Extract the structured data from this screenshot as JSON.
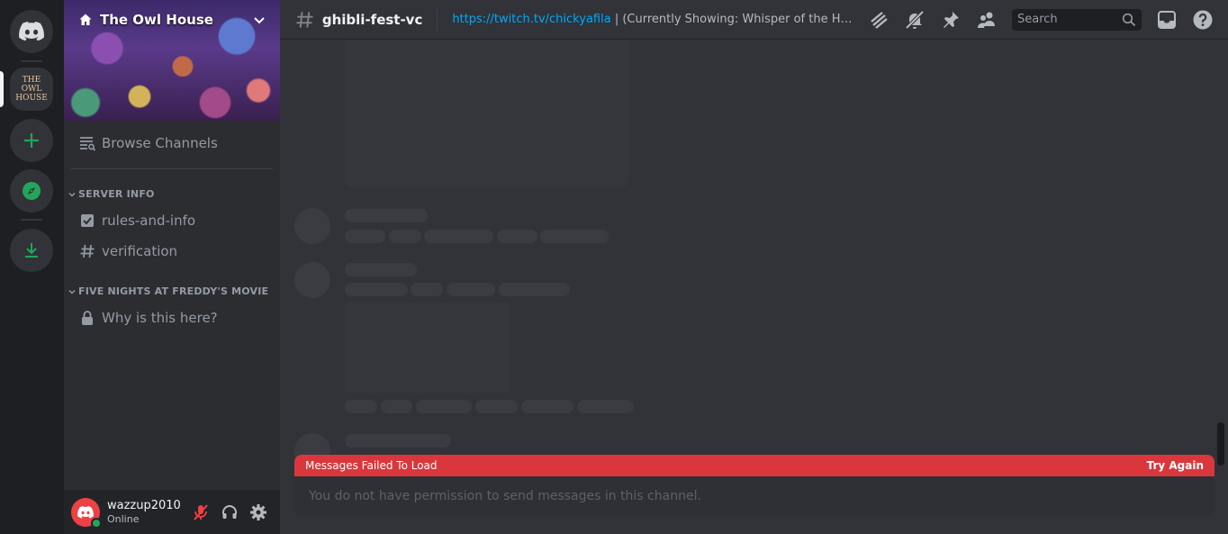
{
  "server": {
    "name": "The Owl House",
    "rail_icon_text": "THE OWL HOUSE"
  },
  "sidebar": {
    "browse_channels": "Browse Channels",
    "categories": [
      {
        "name": "SERVER INFO",
        "channels": [
          "rules-and-info",
          "verification"
        ]
      },
      {
        "name": "FIVE NIGHTS AT FREDDY'S MOVIE",
        "channels": [
          "Why is this here?"
        ]
      }
    ]
  },
  "user": {
    "name": "wazzup2010",
    "status": "Online"
  },
  "header": {
    "channel": "ghibli-fest-vc",
    "topic_link": "https://twitch.tv/chickyafila",
    "topic_rest": " | (Currently Showing: Whisper of the Heart) Ke...",
    "search_placeholder": "Search"
  },
  "messages": {
    "error": "Messages Failed To Load",
    "retry": "Try Again",
    "composer_placeholder": "You do not have permission to send messages in this channel."
  },
  "colors": {
    "accent_error": "#da373c",
    "status_online": "#23a55a",
    "link": "#00a8fc",
    "green_action": "#23a55a"
  },
  "icons": [
    "discord-icon",
    "add-server-icon",
    "explore-icon",
    "download-icon",
    "home-icon",
    "chevron-down-icon",
    "browse-channels-icon",
    "rules-icon",
    "hash-icon",
    "lock-icon",
    "mic-muted-icon",
    "headphones-icon",
    "settings-icon",
    "threads-icon",
    "notifications-muted-icon",
    "pin-icon",
    "members-icon",
    "search-icon",
    "inbox-icon",
    "help-icon"
  ]
}
